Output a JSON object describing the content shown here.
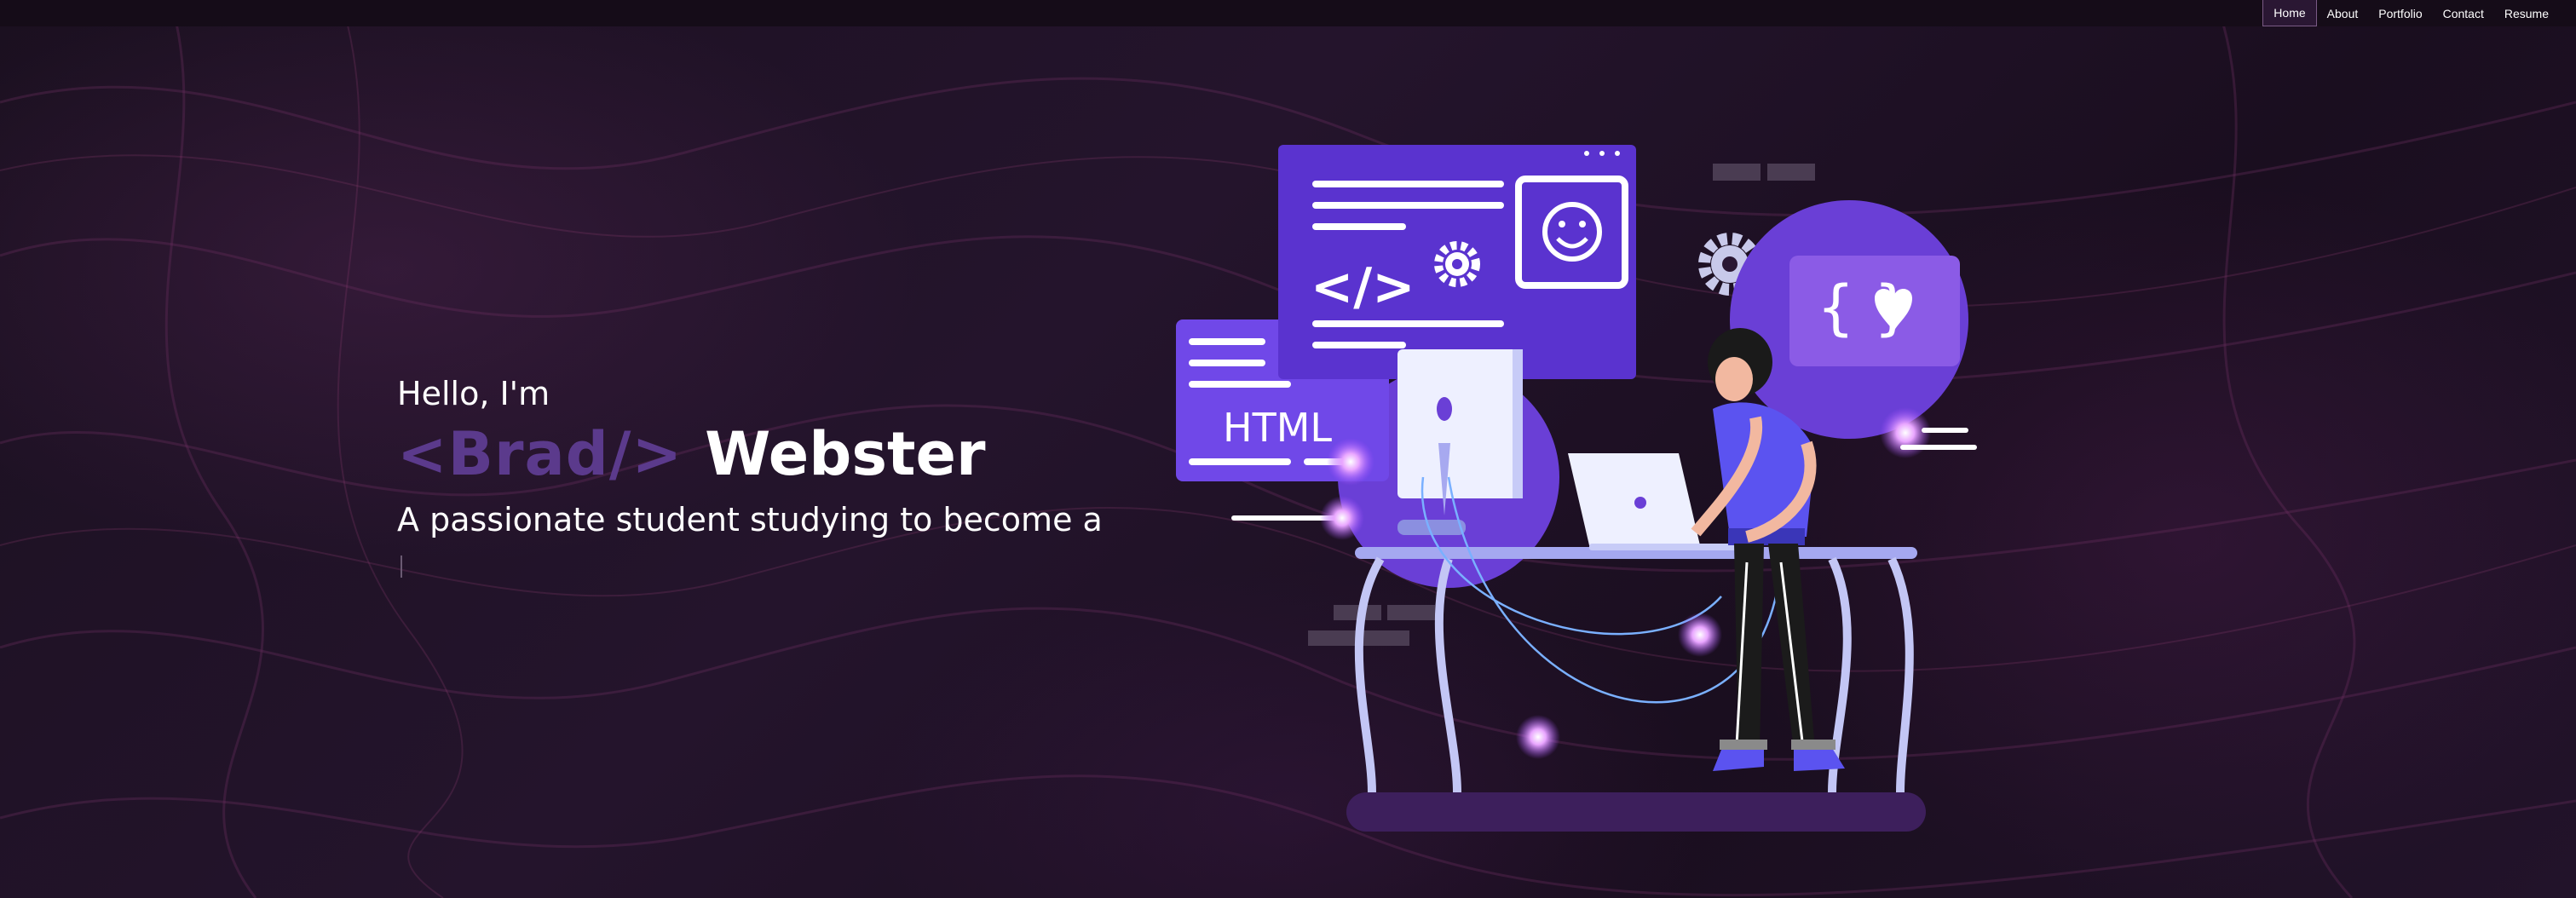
{
  "nav": {
    "items": [
      {
        "label": "Home",
        "active": true
      },
      {
        "label": "About",
        "active": false
      },
      {
        "label": "Portfolio",
        "active": false
      },
      {
        "label": "Contact",
        "active": false
      },
      {
        "label": "Resume",
        "active": false
      }
    ]
  },
  "hero": {
    "greeting": "Hello, I'm",
    "first_name": "<Brad/>",
    "last_name": "Webster",
    "tagline": "A passionate student studying to become a"
  },
  "illustration": {
    "html_label": "HTML",
    "code_symbol": "</>",
    "brace_symbol": "{ }"
  },
  "colors": {
    "accent": "#5b3a8c",
    "panel": "#6a3fd6",
    "background": "#1a0f22"
  }
}
